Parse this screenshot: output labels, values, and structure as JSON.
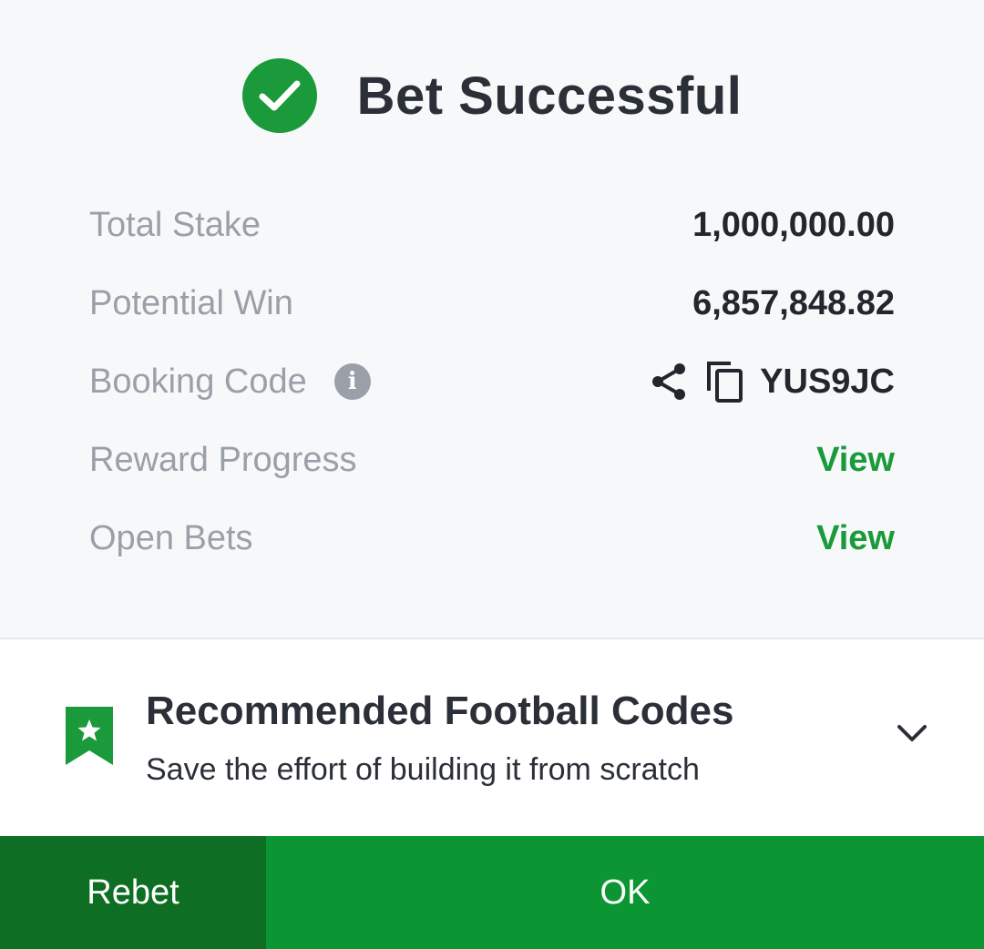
{
  "header": {
    "title": "Bet Successful",
    "icon": "check-circle-icon",
    "icon_color": "#1a9a3a"
  },
  "summary": {
    "total_stake": {
      "label": "Total Stake",
      "value": "1,000,000.00"
    },
    "potential_win": {
      "label": "Potential Win",
      "value": "6,857,848.82"
    },
    "booking_code": {
      "label": "Booking Code",
      "value": "YUS9JC",
      "info_icon": "info-icon",
      "share_icon": "share-icon",
      "copy_icon": "copy-icon"
    },
    "reward_progress": {
      "label": "Reward Progress",
      "link": "View"
    },
    "open_bets": {
      "label": "Open Bets",
      "link": "View"
    }
  },
  "recommended": {
    "title": "Recommended Football Codes",
    "subtitle": "Save the effort of building it from scratch",
    "icon": "bookmark-star-icon",
    "expand_icon": "chevron-down-icon"
  },
  "footer": {
    "rebet_label": "Rebet",
    "ok_label": "OK",
    "rebet_color": "#0e6e23",
    "ok_color": "#0c9633"
  },
  "colors": {
    "accent": "#1a9a3a",
    "muted_text": "#9aa0a8",
    "dark_text": "#22262d"
  }
}
